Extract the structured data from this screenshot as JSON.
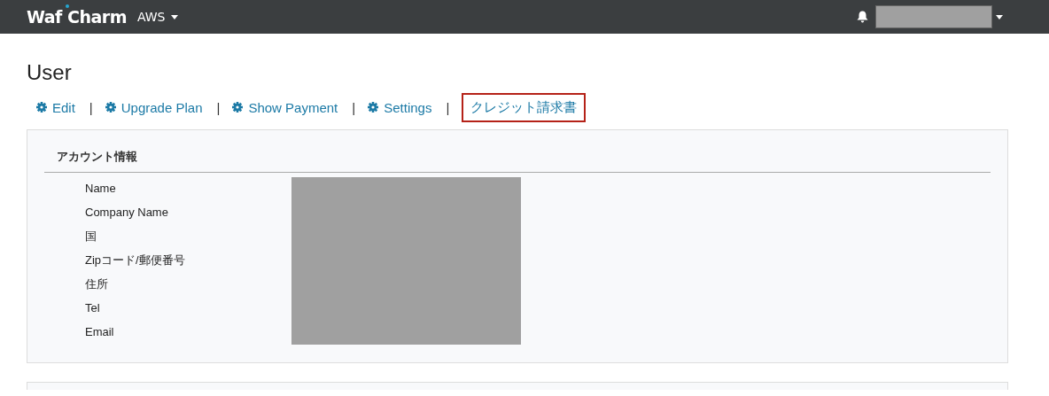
{
  "navbar": {
    "logo": "Waf Charm",
    "menu": "AWS",
    "user_redacted": true
  },
  "page": {
    "title": "User"
  },
  "action_separator": "|",
  "actions": [
    {
      "label": "Edit",
      "kind": "gear",
      "highlighted": false
    },
    {
      "label": "Upgrade Plan",
      "kind": "gear",
      "highlighted": false
    },
    {
      "label": "Show Payment",
      "kind": "gear",
      "highlighted": false
    },
    {
      "label": "Settings",
      "kind": "gear",
      "highlighted": false
    },
    {
      "label": "クレジット請求書",
      "kind": "plain",
      "highlighted": true
    }
  ],
  "account_panel": {
    "heading": "アカウント情報",
    "fields": [
      "Name",
      "Company Name",
      "国",
      "Zipコード/郵便番号",
      "住所",
      "Tel",
      "Email"
    ],
    "values_redacted": true
  }
}
